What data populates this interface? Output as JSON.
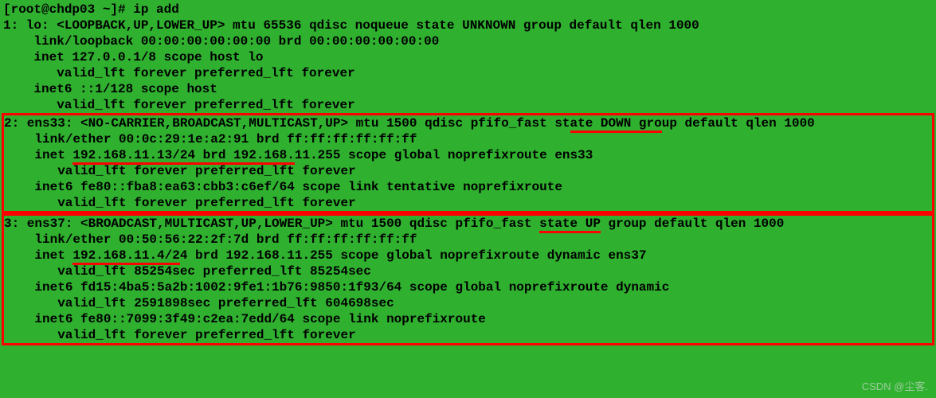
{
  "prompt": "[root@chdp03 ~]# ip add",
  "iface1": {
    "header": "1: lo: <LOOPBACK,UP,LOWER_UP> mtu 65536 qdisc noqueue state UNKNOWN group default qlen 1000",
    "link": "link/loopback 00:00:00:00:00:00 brd 00:00:00:00:00:00",
    "inet": "inet 127.0.0.1/8 scope host lo",
    "valid1": "valid_lft forever preferred_lft forever",
    "inet6": "inet6 ::1/128 scope host",
    "valid2": "valid_lft forever preferred_lft forever"
  },
  "iface2": {
    "header_pre": "2: ens33: <NO-CARRIER,BROADCAST,MULTICAST,UP> mtu 1500 qdisc pfifo_fast st",
    "header_u": "ate DOWN gro",
    "header_post": "up default qlen 1000",
    "link": "link/ether 00:0c:29:1e:a2:91 brd ff:ff:ff:ff:ff:ff",
    "inet_pre": "inet ",
    "inet_u": "192.168.11.13/24 brd 192.168.",
    "inet_post": "11.255 scope global noprefixroute ens33",
    "valid1": "valid_lft forever preferred_lft forever",
    "inet6": "inet6 fe80::fba8:ea63:cbb3:c6ef/64 scope link tentative noprefixroute",
    "valid2": "valid_lft forever preferred_lft forever"
  },
  "iface3": {
    "header_pre": "3: ens37: <BROADCAST,MULTICAST,UP,LOWER_UP> mtu 1500 qdisc pfifo_fast ",
    "header_u": "state UP",
    "header_post": " group default qlen 1000",
    "link": "link/ether 00:50:56:22:2f:7d brd ff:ff:ff:ff:ff:ff",
    "inet_pre": "inet ",
    "inet_u": "192.168.11.4/2",
    "inet_post": "4 brd 192.168.11.255 scope global noprefixroute dynamic ens37",
    "valid1": "valid_lft 85254sec preferred_lft 85254sec",
    "inet6a": "inet6 fd15:4ba5:5a2b:1002:9fe1:1b76:9850:1f93/64 scope global noprefixroute dynamic",
    "valid2": "valid_lft 2591898sec preferred_lft 604698sec",
    "inet6b": "inet6 fe80::7099:3f49:c2ea:7edd/64 scope link noprefixroute",
    "valid3": "valid_lft forever preferred_lft forever"
  },
  "watermark": "CSDN @尘客."
}
